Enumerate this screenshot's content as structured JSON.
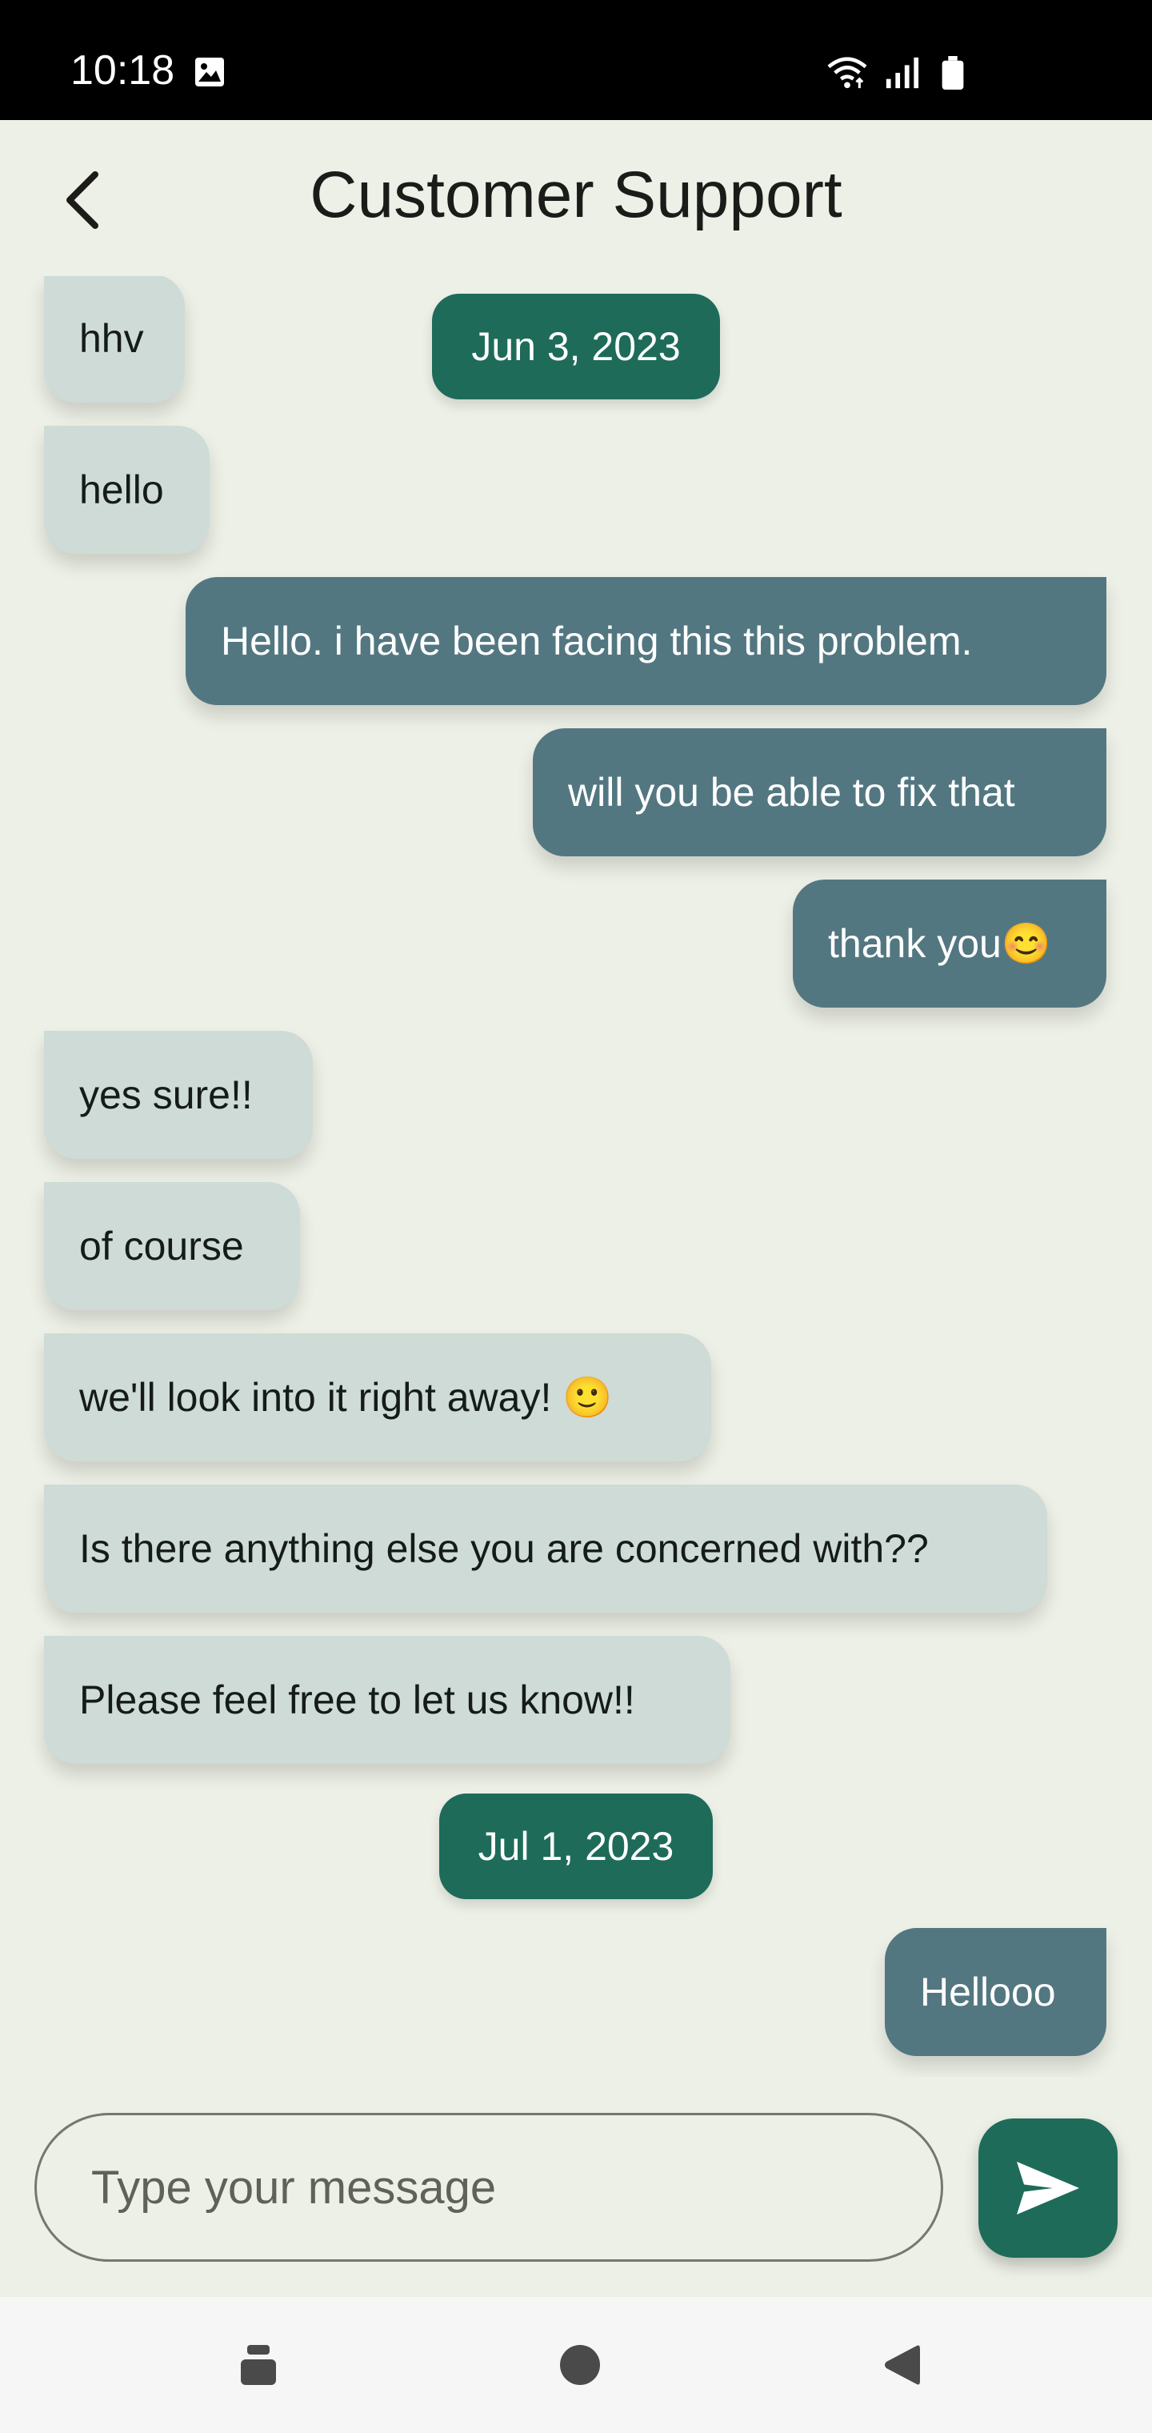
{
  "status_bar": {
    "time": "10:18",
    "icons": [
      "image-icon",
      "wifi-icon",
      "signal-icon",
      "battery-icon"
    ]
  },
  "header": {
    "title": "Customer Support",
    "back_icon": "chevron-left-icon"
  },
  "chat": {
    "date_1": "Jun 3, 2023",
    "date_2": "Jul 1, 2023",
    "messages": [
      {
        "from": "support",
        "text": "hhv"
      },
      {
        "from": "support",
        "text": "hello"
      },
      {
        "from": "user",
        "text": "Hello. i have been facing this this problem."
      },
      {
        "from": "user",
        "text": "will you be able to fix that"
      },
      {
        "from": "user",
        "text": "thank you😊"
      },
      {
        "from": "support",
        "text": "yes sure!!"
      },
      {
        "from": "support",
        "text": "of course"
      },
      {
        "from": "support",
        "text": "we'll look into it right away! 🙂"
      },
      {
        "from": "support",
        "text": "Is there anything else you are concerned with??"
      },
      {
        "from": "support",
        "text": "Please feel free to let us know!!"
      },
      {
        "from": "user",
        "text": "Hellooo"
      }
    ]
  },
  "composer": {
    "placeholder": "Type your message",
    "value": "",
    "send_icon": "send-icon"
  },
  "nav_bar": {
    "icons": [
      "recent-apps-icon",
      "home-icon",
      "back-icon"
    ]
  },
  "colors": {
    "background": "#edf0e6",
    "accent": "#1e6b5a",
    "incoming_bubble": "#cedbd6",
    "outgoing_bubble": "#537781"
  }
}
